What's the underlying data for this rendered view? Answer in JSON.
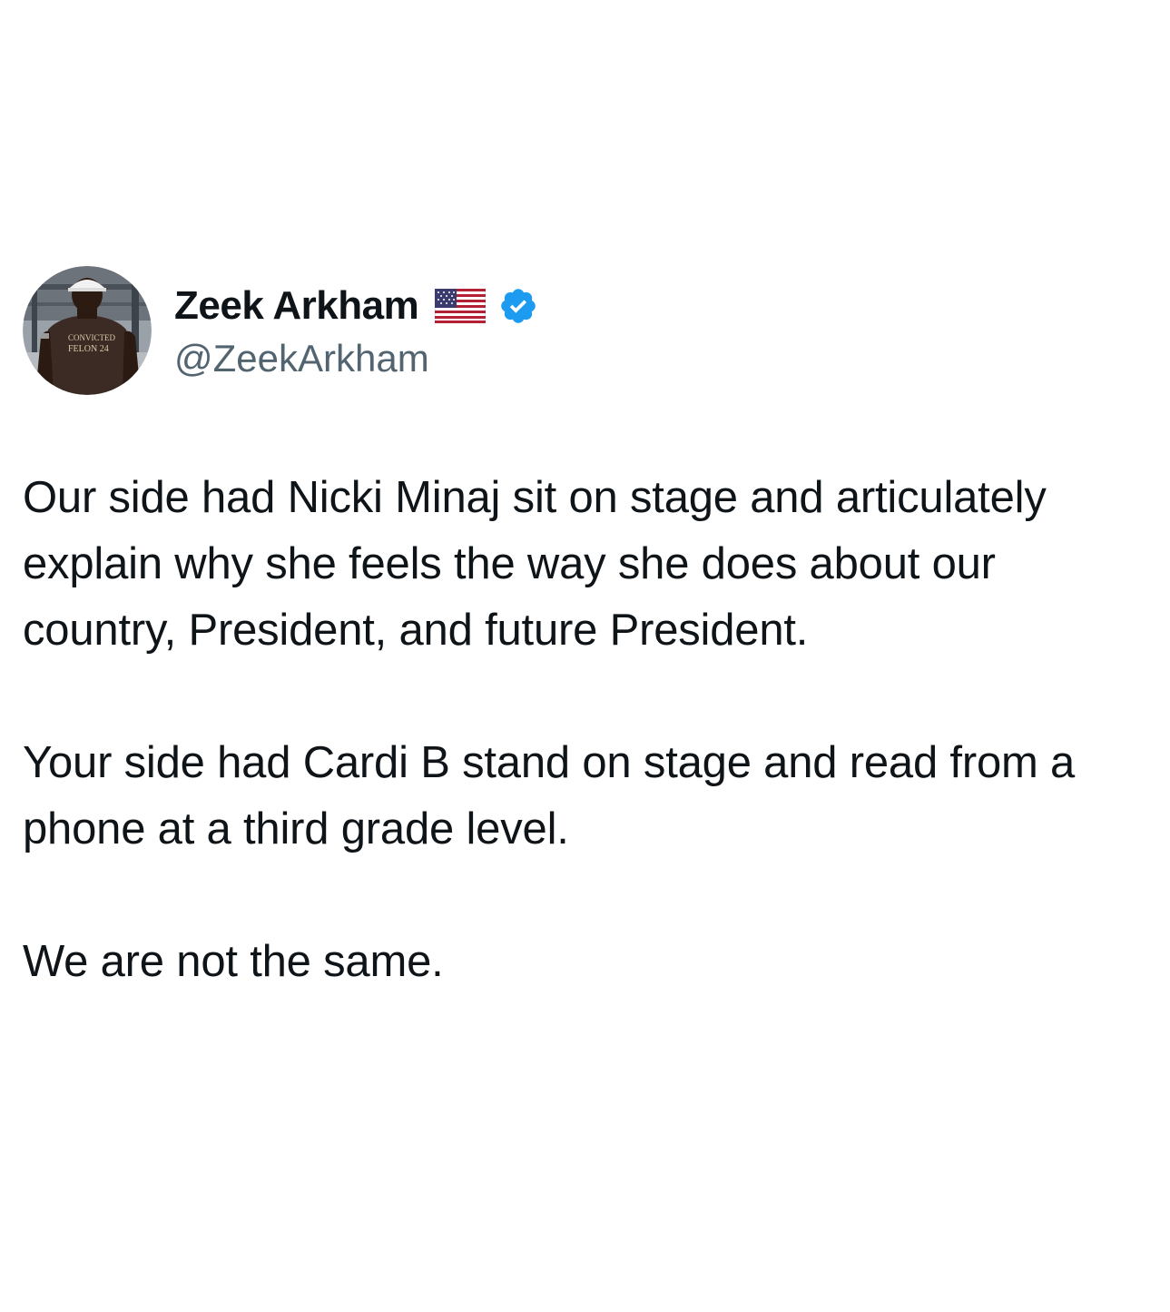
{
  "tweet": {
    "author": {
      "display_name": "Zeek Arkham",
      "handle": "@ZeekArkham",
      "flag_icon": "us-flag-icon",
      "verified_icon": "verified-badge-icon",
      "avatar_shirt_text": "CONVICTED FELON 24"
    },
    "paragraphs": [
      "Our side had Nicki Minaj sit on stage and articulately explain why she feels the way she does about our country, President, and future President.",
      "Your side had Cardi B stand on stage and read from a phone at a third grade level.",
      "We are not the same."
    ]
  },
  "colors": {
    "text_primary": "#0f1419",
    "text_secondary": "#536471",
    "verified_blue": "#1d9bf0",
    "background": "#ffffff"
  }
}
